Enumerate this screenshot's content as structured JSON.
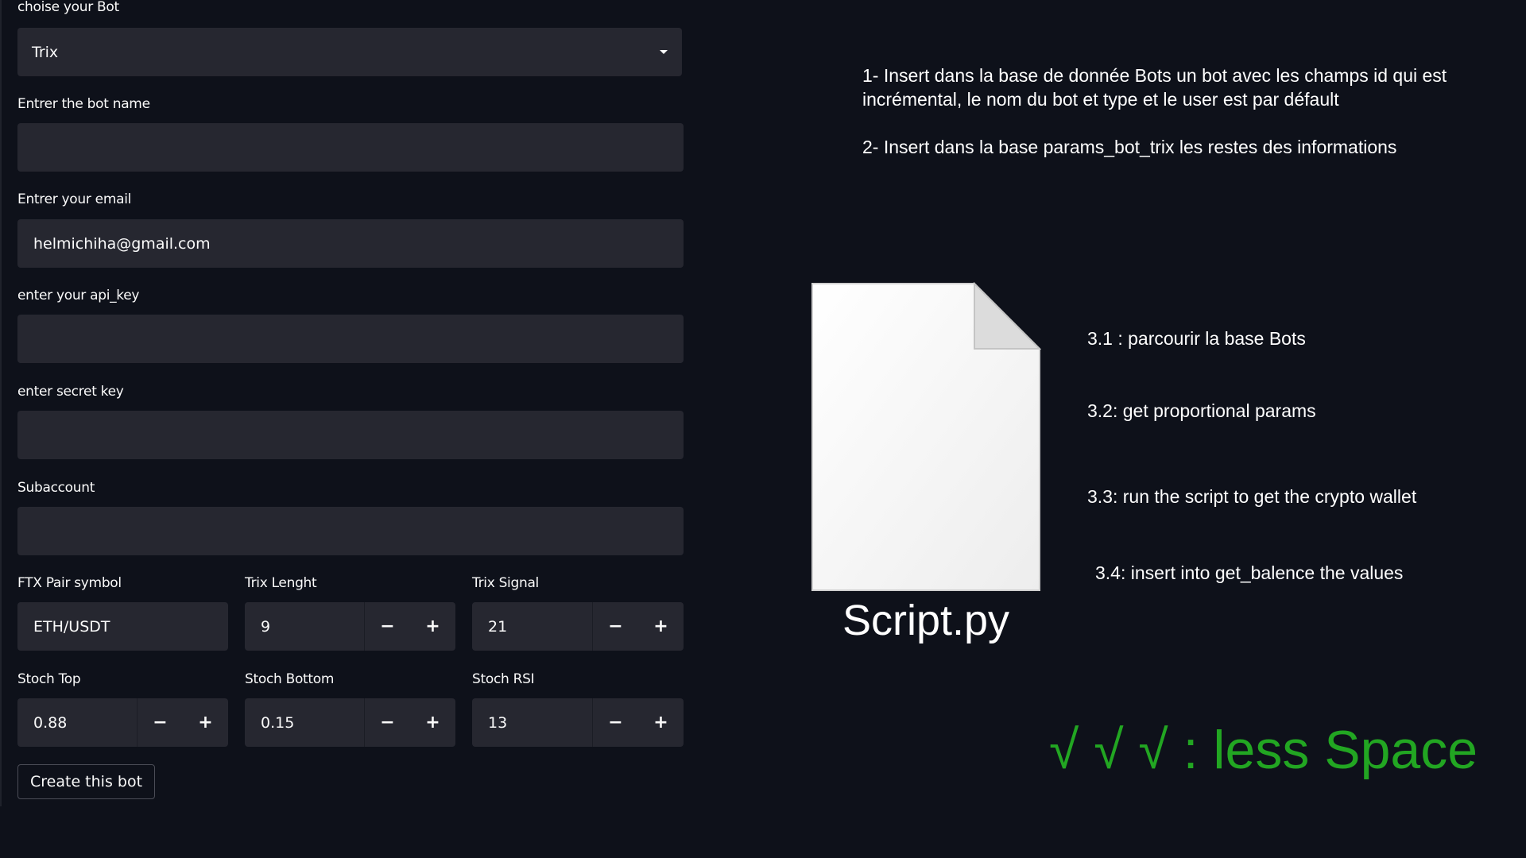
{
  "form": {
    "bot_select": {
      "label": "choise your Bot",
      "value": "Trix"
    },
    "bot_name": {
      "label": "Entrer the bot name",
      "value": ""
    },
    "email": {
      "label": "Entrer your email",
      "value": "helmichiha@gmail.com"
    },
    "api_key": {
      "label": "enter your api_key",
      "value": ""
    },
    "secret_key": {
      "label": "enter secret key",
      "value": ""
    },
    "subaccount": {
      "label": "Subaccount",
      "value": ""
    },
    "pair_symbol": {
      "label": "FTX Pair symbol",
      "value": "ETH/USDT"
    },
    "trix_length": {
      "label": "Trix Lenght",
      "value": "9"
    },
    "trix_signal": {
      "label": "Trix Signal",
      "value": "21"
    },
    "stoch_top": {
      "label": "Stoch Top",
      "value": "0.88"
    },
    "stoch_bottom": {
      "label": "Stoch Bottom",
      "value": "0.15"
    },
    "stoch_rsi": {
      "label": "Stoch RSI",
      "value": "13"
    },
    "stepper": {
      "minus": "−",
      "plus": "+"
    },
    "create_button": "Create this bot"
  },
  "notes": {
    "step1": "1- Insert dans la base de donnée Bots un bot avec les champs id qui est incrémental, le nom du bot et type et le user est par défault",
    "step2": "2- Insert dans la base params_bot_trix les restes des informations",
    "step3_1": "3.1 : parcourir la base Bots",
    "step3_2": "3.2: get proportional params",
    "step3_3": "3.3: run the script to get the crypto wallet",
    "step3_4": "3.4: insert into get_balence the values",
    "script_name": "Script.py",
    "green_note": "√ √ √ : less Space"
  },
  "colors": {
    "background": "#0e111a",
    "field": "#262730",
    "green": "#22a622"
  },
  "icons": {
    "document": "document-icon",
    "dropdown": "chevron-down-icon"
  }
}
